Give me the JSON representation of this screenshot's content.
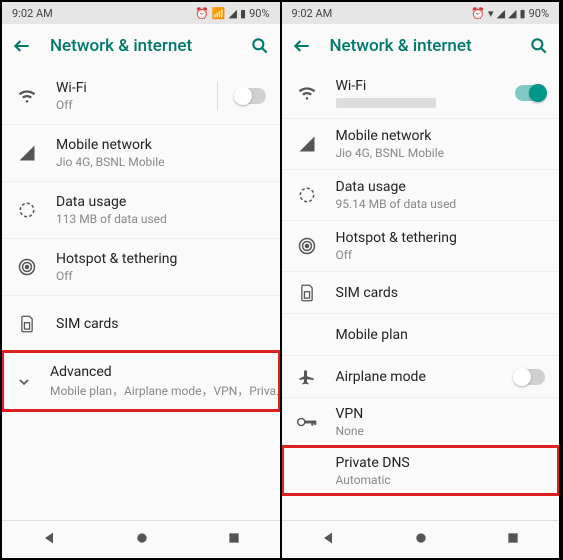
{
  "left": {
    "status_time": "9:02 AM",
    "status_battery": "90%",
    "header_title": "Network & internet",
    "wifi_label": "Wi-Fi",
    "wifi_sub": "Off",
    "mobile_label": "Mobile network",
    "mobile_sub": "Jio 4G, BSNL Mobile",
    "data_label": "Data usage",
    "data_sub": "113 MB of data used",
    "hotspot_label": "Hotspot & tethering",
    "hotspot_sub": "Off",
    "sim_label": "SIM cards",
    "adv_label": "Advanced",
    "adv_sub": "Mobile plan，Airplane mode，VPN，Priva.."
  },
  "right": {
    "status_time": "9:02 AM",
    "status_battery": "90%",
    "header_title": "Network & internet",
    "wifi_label": "Wi-Fi",
    "mobile_label": "Mobile network",
    "mobile_sub": "Jio 4G, BSNL Mobile",
    "data_label": "Data usage",
    "data_sub": "95.14 MB of data used",
    "hotspot_label": "Hotspot & tethering",
    "hotspot_sub": "Off",
    "sim_label": "SIM cards",
    "plan_label": "Mobile plan",
    "airplane_label": "Airplane mode",
    "vpn_label": "VPN",
    "vpn_sub": "None",
    "dns_label": "Private DNS",
    "dns_sub": "Automatic"
  }
}
